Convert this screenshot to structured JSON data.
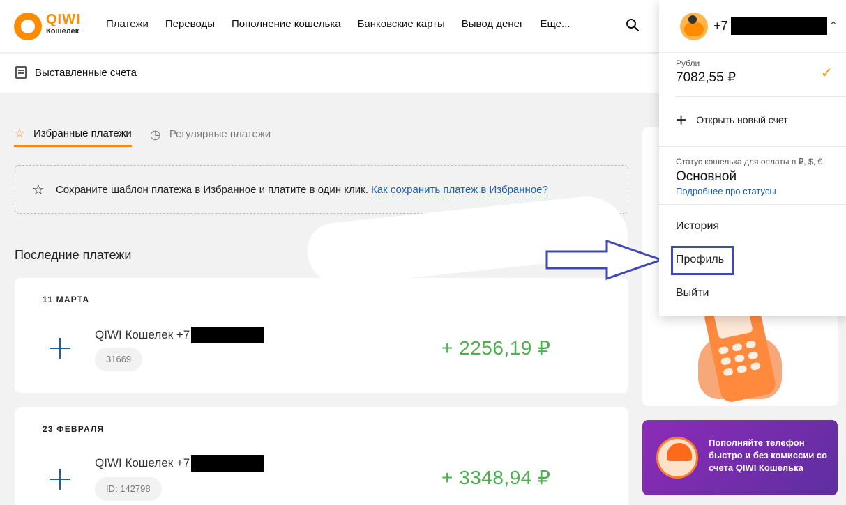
{
  "header": {
    "logo": {
      "brand": "QIWI",
      "subtitle": "Кошелек"
    },
    "nav": [
      "Платежи",
      "Переводы",
      "Пополнение кошелька",
      "Банковские карты",
      "Вывод денег",
      "Еще..."
    ]
  },
  "subheader": {
    "invoices_label": "Выставленные счета"
  },
  "tabs": [
    {
      "label": "Избранные платежи",
      "icon": "star-icon",
      "active": true
    },
    {
      "label": "Регулярные платежи",
      "icon": "clock-icon",
      "active": false
    }
  ],
  "favorites_hint": {
    "text": "Сохраните шаблон платежа в Избранное и платите в один клик.",
    "link": "Как сохранить платеж в Избранное?"
  },
  "recent": {
    "title": "Последние платежи",
    "payments": [
      {
        "date": "11 МАРТА",
        "title": "QIWI Кошелек +7",
        "tag": "31669",
        "amount": "+ 2256,19 ₽"
      },
      {
        "date": "23 ФЕВРАЛЯ",
        "title": "QIWI Кошелек +7",
        "tag": "ID: 142798",
        "amount": "+ 3348,94 ₽"
      }
    ]
  },
  "promo": {
    "text": "Пополняйте телефон быстро и без комиссии со счета QIWI Кошелька"
  },
  "dropdown": {
    "phone_prefix": "+7",
    "balance_label": "Рубли",
    "balance": "7082,55 ₽",
    "open_account": "Открыть новый счет",
    "status_label": "Статус кошелька для оплаты в ₽, $, €",
    "status": "Основной",
    "status_link": "Подробнее про статусы",
    "menu": [
      "История",
      "Профиль",
      "Выйти"
    ]
  },
  "colors": {
    "accent": "#ff8c00",
    "link": "#1b5fa8",
    "positive": "#4caf50",
    "annotation": "#3f48b8"
  }
}
